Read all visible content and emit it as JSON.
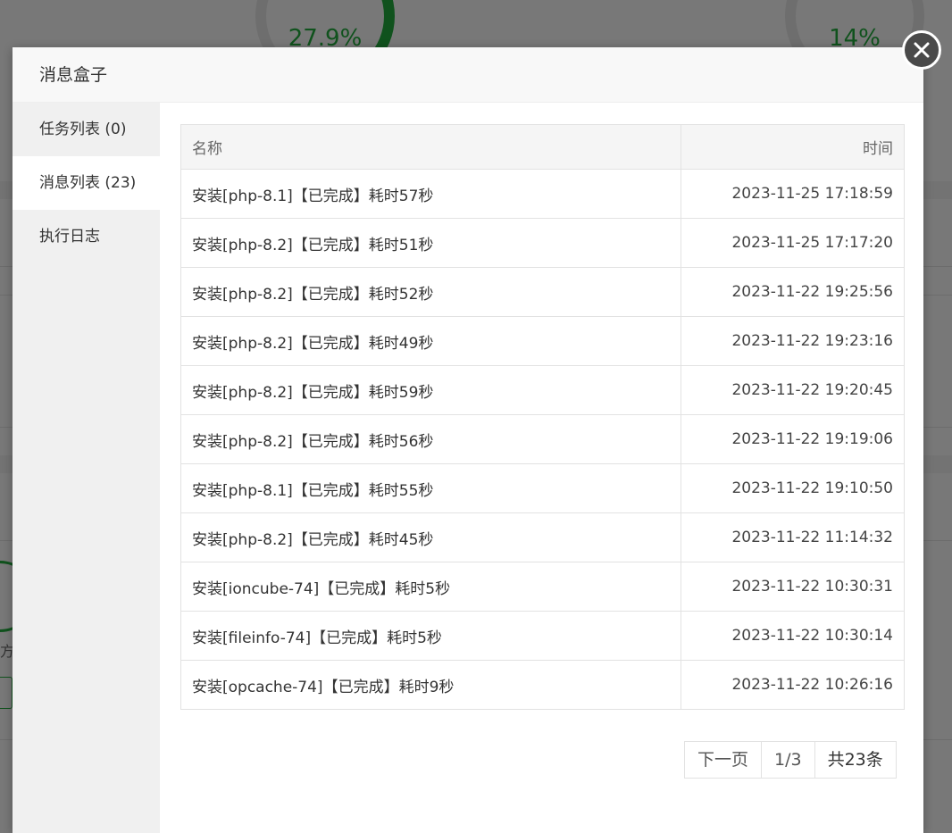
{
  "background": {
    "gauge_1": "27.9%",
    "gauge_2": "14%",
    "partial_text": "方"
  },
  "dialog": {
    "title": "消息盒子",
    "close_icon": "close-icon"
  },
  "sidebar": {
    "items": [
      {
        "label": "任务列表 (0)",
        "active": false
      },
      {
        "label": "消息列表 (23)",
        "active": true
      },
      {
        "label": "执行日志",
        "active": false
      }
    ]
  },
  "table": {
    "headers": {
      "name": "名称",
      "time": "时间"
    },
    "rows": [
      {
        "name": "安装[php-8.1]【已完成】耗时57秒",
        "time": "2023-11-25 17:18:59"
      },
      {
        "name": "安装[php-8.2]【已完成】耗时51秒",
        "time": "2023-11-25 17:17:20"
      },
      {
        "name": "安装[php-8.2]【已完成】耗时52秒",
        "time": "2023-11-22 19:25:56"
      },
      {
        "name": "安装[php-8.2]【已完成】耗时49秒",
        "time": "2023-11-22 19:23:16"
      },
      {
        "name": "安装[php-8.2]【已完成】耗时59秒",
        "time": "2023-11-22 19:20:45"
      },
      {
        "name": "安装[php-8.2]【已完成】耗时56秒",
        "time": "2023-11-22 19:19:06"
      },
      {
        "name": "安装[php-8.1]【已完成】耗时55秒",
        "time": "2023-11-22 19:10:50"
      },
      {
        "name": "安装[php-8.2]【已完成】耗时45秒",
        "time": "2023-11-22 11:14:32"
      },
      {
        "name": "安装[ioncube-74]【已完成】耗时5秒",
        "time": "2023-11-22 10:30:31"
      },
      {
        "name": "安装[fileinfo-74]【已完成】耗时5秒",
        "time": "2023-11-22 10:30:14"
      },
      {
        "name": "安装[opcache-74]【已完成】耗时9秒",
        "time": "2023-11-22 10:26:16"
      }
    ]
  },
  "pagination": {
    "next_label": "下一页",
    "page": "1/3",
    "total": "共23条"
  },
  "colors": {
    "accent": "#20a53a",
    "sidebar_bg": "#f0f0f0",
    "header_bg": "#f8f8f8"
  }
}
